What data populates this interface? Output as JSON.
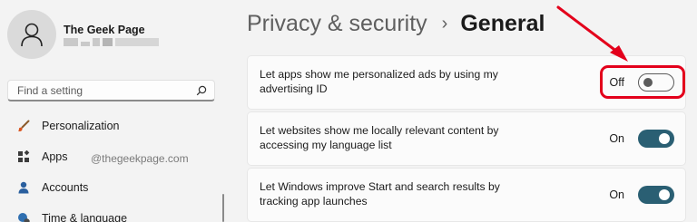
{
  "user": {
    "name": "The Geek Page"
  },
  "search": {
    "placeholder": "Find a setting",
    "icon": "search-icon"
  },
  "nav": [
    {
      "label": "Personalization",
      "icon": "brush-icon"
    },
    {
      "label": "Apps",
      "icon": "apps-icon"
    },
    {
      "label": "Accounts",
      "icon": "person-icon"
    },
    {
      "label": "Time & language",
      "icon": "globe-clock-icon"
    }
  ],
  "watermark": "@thegeekpage.com",
  "breadcrumb": {
    "parent": "Privacy & security",
    "separator": "›",
    "current": "General"
  },
  "settings": [
    {
      "text": "Let apps show me personalized ads by using my advertising ID",
      "state": "Off",
      "on": false
    },
    {
      "text": "Let websites show me locally relevant content by accessing my language list",
      "state": "On",
      "on": true
    },
    {
      "text": "Let Windows improve Start and search results by tracking app launches",
      "state": "On",
      "on": true
    }
  ],
  "colors": {
    "accent": "#2a5f73",
    "highlight": "#e3001b"
  }
}
